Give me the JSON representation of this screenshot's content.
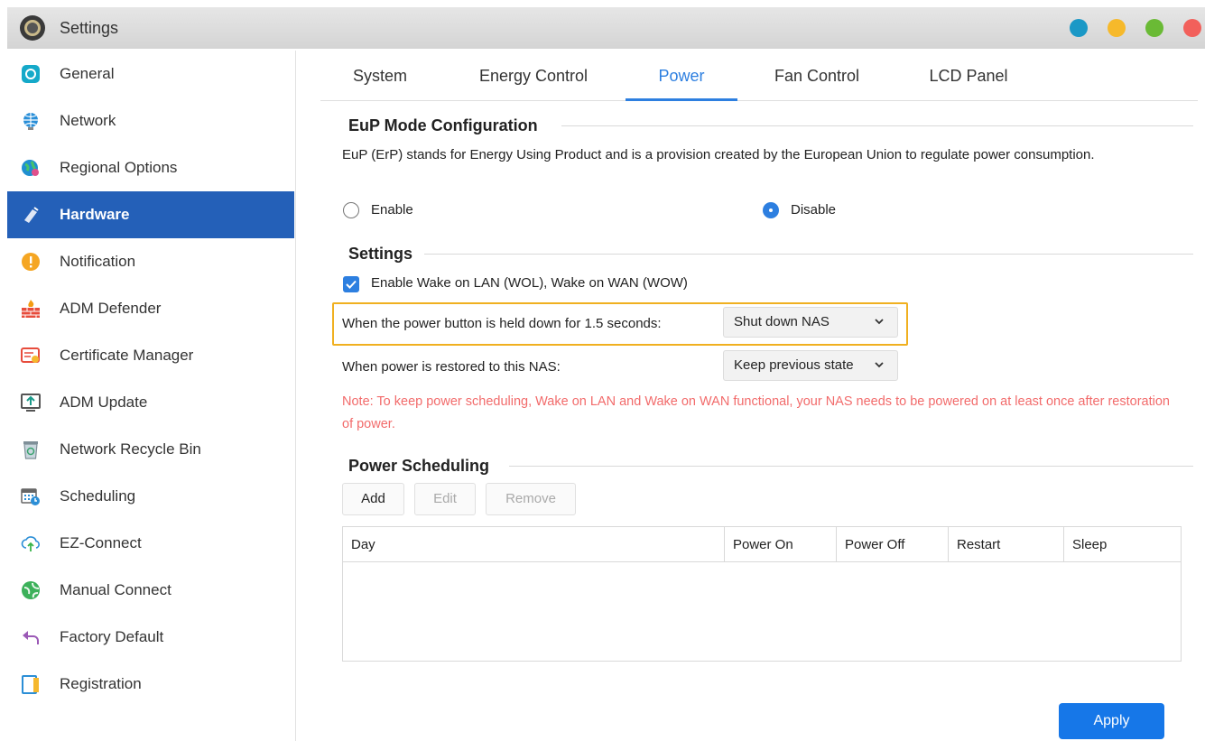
{
  "window": {
    "title": "Settings",
    "controls": [
      {
        "name": "window-dot-teal",
        "color": "#1a98c6"
      },
      {
        "name": "window-dot-yellow",
        "color": "#f6b92b"
      },
      {
        "name": "window-dot-green",
        "color": "#6aba35"
      },
      {
        "name": "window-dot-red",
        "color": "#f2605b"
      }
    ]
  },
  "sidebar": {
    "active_color": "#2460b8",
    "items": [
      {
        "label": "General",
        "icon": "general-icon"
      },
      {
        "label": "Network",
        "icon": "network-globe-icon"
      },
      {
        "label": "Regional Options",
        "icon": "regional-globe-icon"
      },
      {
        "label": "Hardware",
        "icon": "hardware-icon",
        "active": true
      },
      {
        "label": "Notification",
        "icon": "notification-icon"
      },
      {
        "label": "ADM Defender",
        "icon": "firewall-icon"
      },
      {
        "label": "Certificate Manager",
        "icon": "certificate-icon"
      },
      {
        "label": "ADM Update",
        "icon": "update-icon"
      },
      {
        "label": "Network Recycle Bin",
        "icon": "recycle-bin-icon"
      },
      {
        "label": "Scheduling",
        "icon": "calendar-clock-icon"
      },
      {
        "label": "EZ-Connect",
        "icon": "cloud-upload-icon"
      },
      {
        "label": "Manual Connect",
        "icon": "manual-connect-icon"
      },
      {
        "label": "Factory Default",
        "icon": "undo-arrow-icon"
      },
      {
        "label": "Registration",
        "icon": "registration-icon"
      }
    ]
  },
  "tabs": [
    {
      "label": "System"
    },
    {
      "label": "Energy Control"
    },
    {
      "label": "Power",
      "active": true
    },
    {
      "label": "Fan Control"
    },
    {
      "label": "LCD Panel"
    }
  ],
  "eup": {
    "title": "EuP Mode Configuration",
    "description": "EuP (ErP) stands for Energy Using Product and is a provision created by the European Union to regulate power consumption.",
    "enable_label": "Enable",
    "disable_label": "Disable",
    "selected": "Disable"
  },
  "settings": {
    "title": "Settings",
    "wol_label": "Enable Wake on LAN (WOL), Wake on WAN (WOW)",
    "wol_checked": true,
    "power_button_label": "When the power button is held down for 1.5 seconds:",
    "power_button_value": "Shut down NAS",
    "power_restore_label": "When power is restored to this NAS:",
    "power_restore_value": "Keep previous state",
    "note": "Note: To keep power scheduling, Wake on LAN and Wake on WAN functional, your NAS needs to be powered on at least once after restoration of power."
  },
  "scheduling": {
    "title": "Power Scheduling",
    "add_label": "Add",
    "edit_label": "Edit",
    "remove_label": "Remove",
    "columns": [
      "Day",
      "Power On",
      "Power Off",
      "Restart",
      "Sleep"
    ],
    "rows": []
  },
  "apply_label": "Apply",
  "colors": {
    "accent": "#2d7fe0",
    "note": "#f26b6b",
    "highlight": "#f0b020",
    "apply": "#1677e8"
  }
}
